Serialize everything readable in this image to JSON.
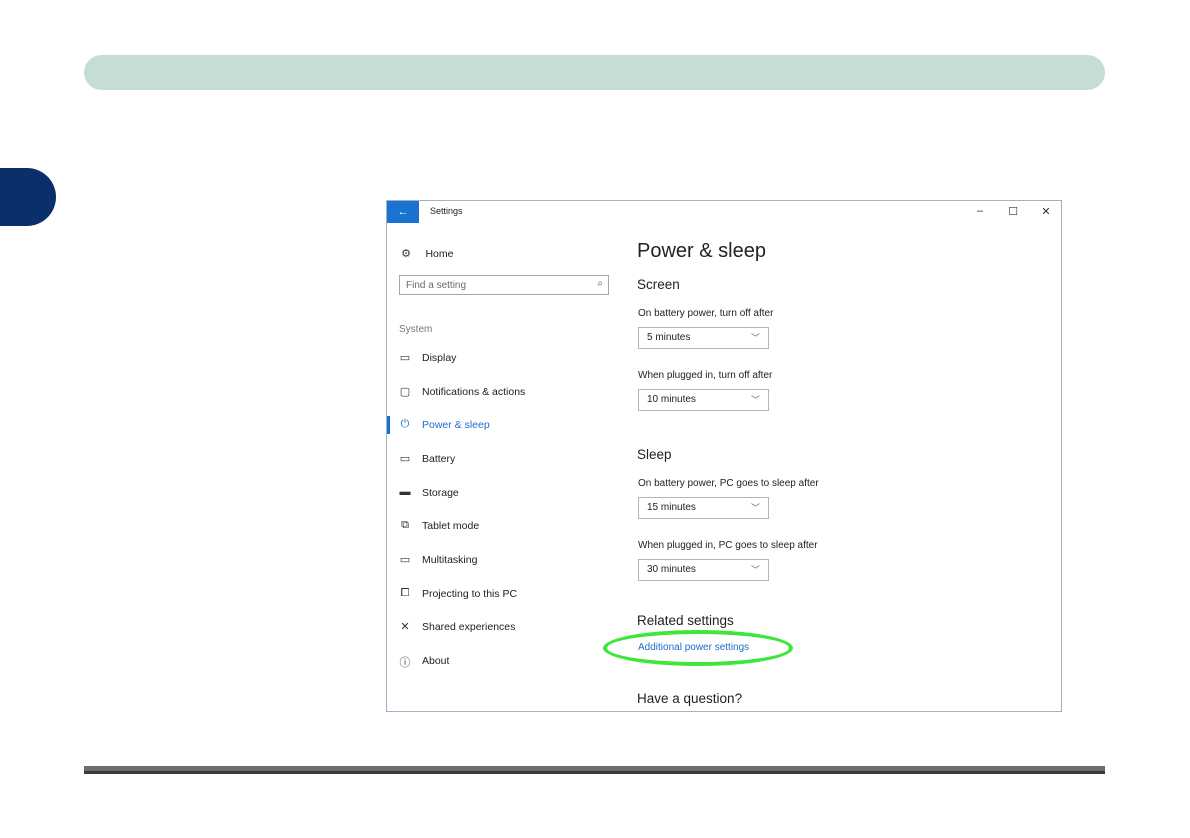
{
  "window": {
    "title": "Settings",
    "back_icon": "←",
    "minimize_icon": "–",
    "maximize_icon": "☐",
    "close_icon": "✕"
  },
  "sidebar": {
    "home_label": "Home",
    "home_icon": "⚙",
    "search_placeholder": "Find a setting",
    "search_icon": "⌕",
    "section_label": "System",
    "items": [
      {
        "label": "Display",
        "icon": "▭",
        "active": false
      },
      {
        "label": "Notifications & actions",
        "icon": "▢",
        "active": false
      },
      {
        "label": "Power & sleep",
        "icon": "⏻",
        "active": true
      },
      {
        "label": "Battery",
        "icon": "▭",
        "active": false
      },
      {
        "label": "Storage",
        "icon": "▬",
        "active": false
      },
      {
        "label": "Tablet mode",
        "icon": "⧉",
        "active": false
      },
      {
        "label": "Multitasking",
        "icon": "▭",
        "active": false
      },
      {
        "label": "Projecting to this PC",
        "icon": "⧠",
        "active": false
      },
      {
        "label": "Shared experiences",
        "icon": "✕",
        "active": false
      },
      {
        "label": "About",
        "icon": "ⓘ",
        "active": false
      }
    ]
  },
  "main": {
    "title": "Power & sleep",
    "screen": {
      "heading": "Screen",
      "battery_label": "On battery power, turn off after",
      "battery_value": "5 minutes",
      "plugged_label": "When plugged in, turn off after",
      "plugged_value": "10 minutes"
    },
    "sleep": {
      "heading": "Sleep",
      "battery_label": "On battery power, PC goes to sleep after",
      "battery_value": "15 minutes",
      "plugged_label": "When plugged in, PC goes to sleep after",
      "plugged_value": "30 minutes"
    },
    "related": {
      "heading": "Related settings",
      "link": "Additional power settings"
    },
    "question_heading": "Have a question?",
    "chevron_icon": "﹀"
  },
  "colors": {
    "accent": "#1a6fc9",
    "highlight": "#3ee63a",
    "header_band": "#c6ddd6",
    "chapter_tab": "#0a2f6b"
  }
}
